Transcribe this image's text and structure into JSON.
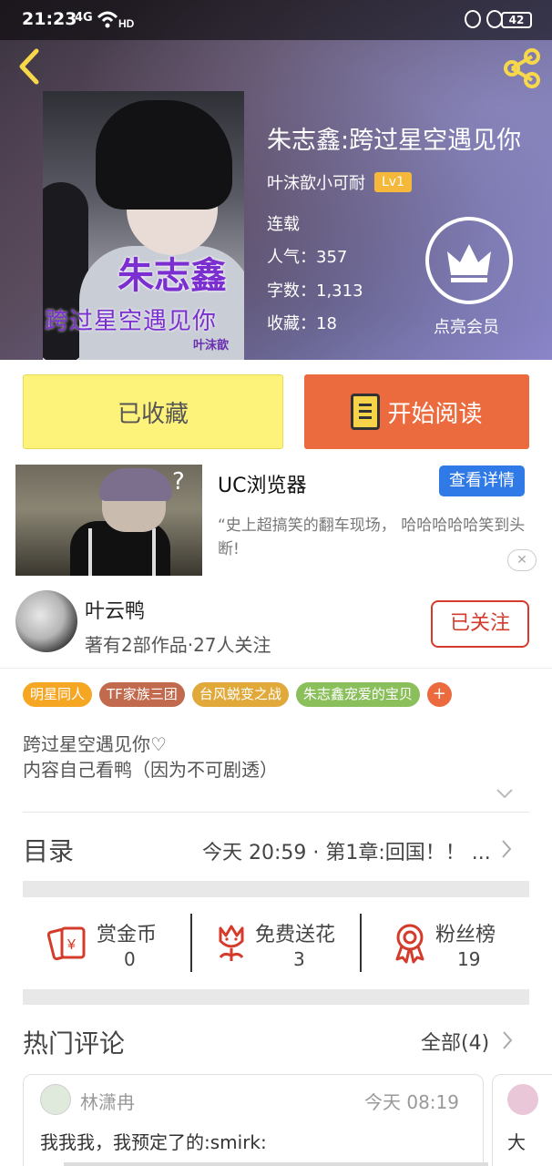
{
  "status_bar": {
    "time": "21:23",
    "signal": "4G",
    "battery": "42"
  },
  "book": {
    "title": "朱志鑫:跨过星空遇见你",
    "author": "叶沫歆小可耐",
    "level": "Lv1",
    "status": "连载",
    "popularity": "人气：357",
    "words": "字数：1,313",
    "favorites": "收藏：18",
    "vip_label": "点亮会员",
    "cover_title": "朱志鑫",
    "cover_subtitle": "跨过星空遇见你",
    "cover_author": "叶沫歆"
  },
  "actions": {
    "favorited": "已收藏",
    "read": "开始阅读"
  },
  "ad": {
    "title": "UC浏览器",
    "detail": "查看详情",
    "desc": "“史上超搞笑的翻车现场， 哈哈哈哈哈笑到头断!",
    "close": "✕"
  },
  "writer": {
    "name": "叶云鸭",
    "meta": "著有2部作品·27人关注",
    "follow": "已关注"
  },
  "tags": [
    {
      "label": "明星同人",
      "color": "#f5a623"
    },
    {
      "label": "TF家族三团",
      "color": "#c26a4d"
    },
    {
      "label": "台风蜕变之战",
      "color": "#e0a93a"
    },
    {
      "label": "朱志鑫宠爱的宝贝",
      "color": "#8bbf5b"
    }
  ],
  "tag_add": "+",
  "intro": {
    "line1": "跨过星空遇见你♡",
    "line2": "内容自己看鸭（因为不可剧透）"
  },
  "toc": {
    "title": "目录",
    "latest": "今天 20:59 · 第1章:回国！！ ..."
  },
  "stats": [
    {
      "label": "赏金币",
      "value": "0"
    },
    {
      "label": "免费送花",
      "value": "3"
    },
    {
      "label": "粉丝榜",
      "value": "19"
    }
  ],
  "comments": {
    "title": "热门评论",
    "all": "全部(4)",
    "items": [
      {
        "name": "林潇冉",
        "time": "今天 08:19",
        "text": "我我我，我预定了的:smirk:"
      },
      {
        "text": "大"
      }
    ]
  },
  "colors": {
    "accent": "#ec6b3e",
    "favorite_bg": "#fdf27a",
    "follow": "#d43b2a",
    "ad_button": "#2f7ae6"
  }
}
